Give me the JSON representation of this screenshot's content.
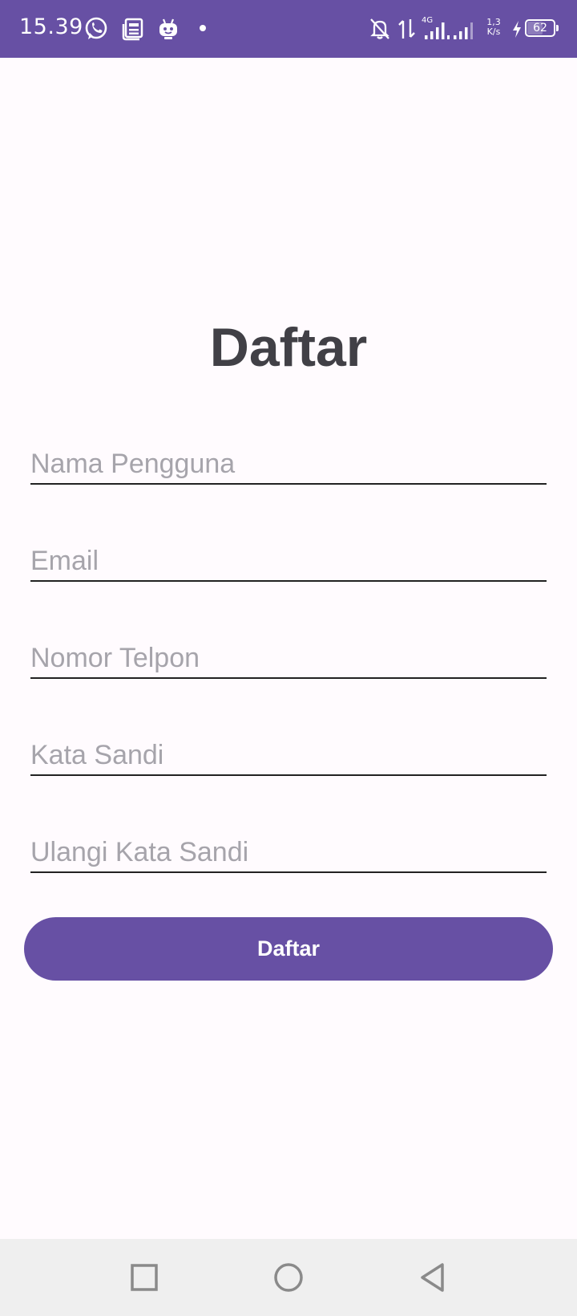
{
  "status_bar": {
    "time": "15.39",
    "network_type": "4G",
    "speed_value": "1,3",
    "speed_unit": "K/s",
    "battery_level": "62",
    "battery_fraction": 0.62
  },
  "colors": {
    "primary": "#6750a4",
    "background": "#fffbfe",
    "title": "#414046",
    "placeholder": "#a6a4ab",
    "nav_bar": "#efefef"
  },
  "page": {
    "title": "Daftar"
  },
  "form": {
    "fields": [
      {
        "placeholder": "Nama Pengguna",
        "value": ""
      },
      {
        "placeholder": "Email",
        "value": ""
      },
      {
        "placeholder": "Nomor Telpon",
        "value": ""
      },
      {
        "placeholder": "Kata Sandi",
        "value": ""
      },
      {
        "placeholder": "Ulangi Kata Sandi",
        "value": ""
      }
    ],
    "submit_label": "Daftar"
  },
  "nav_bar": {
    "recents_icon": "square-icon",
    "home_icon": "circle-icon",
    "back_icon": "triangle-back-icon"
  }
}
